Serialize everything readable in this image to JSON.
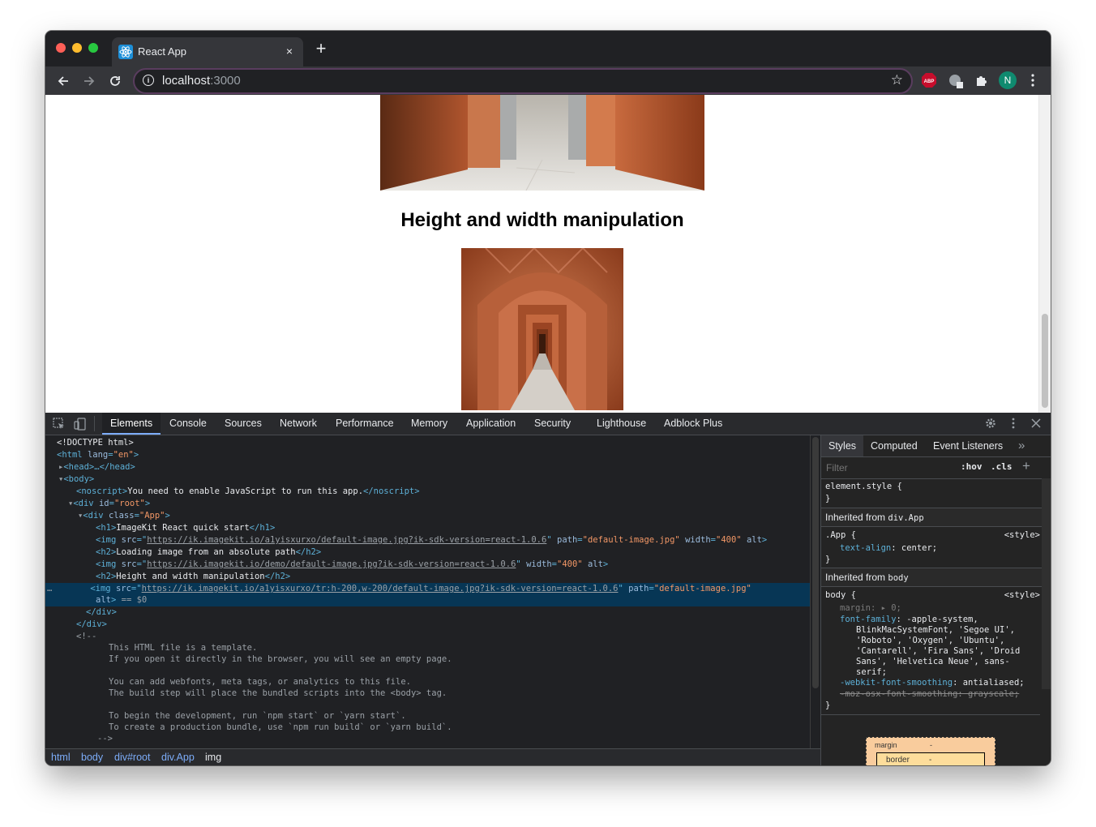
{
  "browser": {
    "tab_title": "React App",
    "tab_close": "×",
    "new_tab": "+",
    "url_host": "localhost",
    "url_port": ":3000",
    "profile_initial": "N",
    "abp_label": "ABP",
    "icons": [
      "back-arrow-icon",
      "forward-arrow-icon",
      "reload-icon",
      "info-icon",
      "star-icon",
      "adblock-icon",
      "extension-icon",
      "puzzle-icon",
      "kebab-menu-icon"
    ]
  },
  "page": {
    "heading": "Height and width manipulation"
  },
  "devtools": {
    "tabs": [
      "Elements",
      "Console",
      "Sources",
      "Network",
      "Performance",
      "Memory",
      "Application",
      "Security",
      "Lighthouse",
      "Adblock Plus"
    ],
    "active_tab": "Elements",
    "dom": {
      "doctype": "<!DOCTYPE html>",
      "html_open": "<html",
      "lang_attr": "lang",
      "lang_val": "\"en\"",
      "head": "<head>…</head>",
      "body": "<body>",
      "noscript_open": "<noscript>",
      "noscript_text": "You need to enable JavaScript to run this app.",
      "noscript_close": "</noscript>",
      "div_root_open": "<div",
      "id_attr": "id",
      "id_val": "\"root\"",
      "div_app_open": "<div",
      "class_attr": "class",
      "class_val": "\"App\"",
      "h1_open": "<h1>",
      "h1_text": "ImageKit React quick start",
      "h1_close": "</h1>",
      "img": "<img",
      "src": "src",
      "img1_src": "https://ik.imagekit.io/a1yisxurxo/default-image.jpg?ik-sdk-version=react-1.0.6",
      "path": "path",
      "img1_path": "\"default-image.jpg\"",
      "width": "width",
      "width_val": "\"400\"",
      "alt": "alt",
      "h2_open": "<h2>",
      "h2_1_text": "Loading image from an absolute path",
      "h2_close": "</h2>",
      "img2_src": "https://ik.imagekit.io/demo/default-image.jpg?ik-sdk-version=react-1.0.6",
      "h2_2_text": "Height and width manipulation",
      "img3_src": "https://ik.imagekit.io/a1yisxurxo/tr:h-200,w-200/default-image.jpg?ik-sdk-version=react-1.0.6",
      "img3_path": "\"default-image.jpg\"",
      "selected_suffix": " == $0",
      "div_close": "</div>",
      "comment_open": "<!--",
      "comment_lines": [
        "This HTML file is a template.",
        "If you open it directly in the browser, you will see an empty page.",
        "",
        "You can add webfonts, meta tags, or analytics to this file.",
        "The build step will place the bundled scripts into the <body> tag.",
        "",
        "To begin the development, run `npm start` or `yarn start`.",
        "To create a production bundle, use `npm run build` or `yarn build`."
      ],
      "comment_close": "-->"
    },
    "breadcrumbs": [
      "html",
      "body",
      "div#root",
      "div.App",
      "img"
    ],
    "styles": {
      "tabs": [
        "Styles",
        "Computed",
        "Event Listeners"
      ],
      "more": "»",
      "filter_placeholder": "Filter",
      "hov": ":hov",
      "cls": ".cls",
      "plus": "+",
      "element_style": "element.style {",
      "close_brace": "}",
      "inherited_app": "Inherited from",
      "inherited_app_sel": "div.App",
      "app_selector": ".App {",
      "style_source": "<style>",
      "text_align_prop": "text-align",
      "text_align_val": "center;",
      "inherited_body": "Inherited from",
      "inherited_body_sel": "body",
      "body_selector": "body {",
      "margin_prop": "margin",
      "margin_val": "0;",
      "font_family_prop": "font-family",
      "font_family_val": [
        "-apple-system,",
        "BlinkMacSystemFont, 'Segoe UI',",
        "'Roboto', 'Oxygen', 'Ubuntu',",
        "'Cantarell', 'Fira Sans', 'Droid",
        "Sans', 'Helvetica Neue', sans-",
        "serif;"
      ],
      "smoothing_prop": "-webkit-font-smoothing",
      "smoothing_val": "antialiased;",
      "moz_line": "-moz-osx-font-smoothing: grayscale;",
      "box_margin": "margin",
      "box_border": "border",
      "box_dash": "-"
    }
  }
}
